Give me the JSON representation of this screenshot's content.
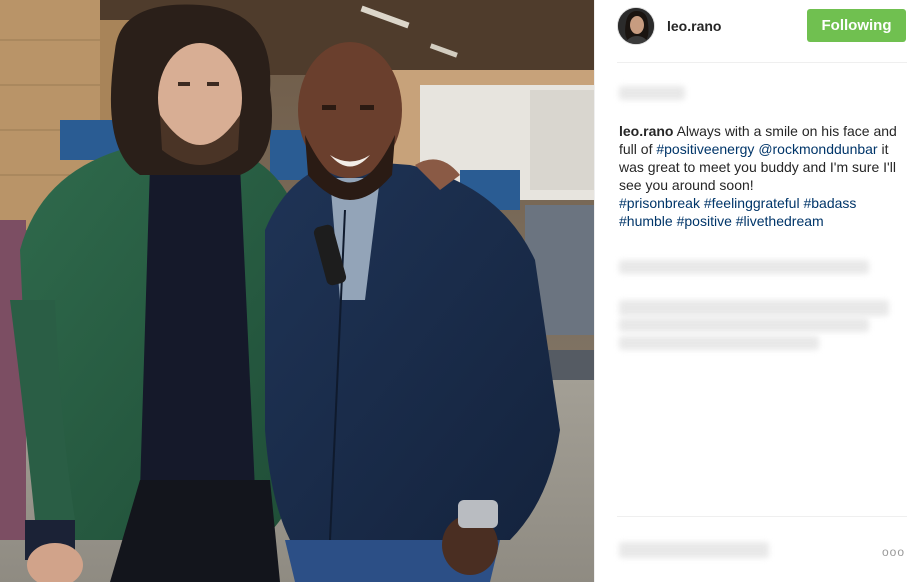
{
  "post": {
    "username": "leo.rano",
    "follow_label": "Following",
    "caption_user": "leo.rano",
    "caption_parts": [
      {
        "type": "text",
        "text": " Always with a smile on his face and full of "
      },
      {
        "type": "tag",
        "text": "#positiveenergy"
      },
      {
        "type": "text",
        "text": " "
      },
      {
        "type": "tag",
        "text": "@rockmonddunbar"
      },
      {
        "type": "text",
        "text": " it was great to meet you buddy and I'm sure I'll see you around soon!"
      },
      {
        "type": "br"
      },
      {
        "type": "tag",
        "text": "#prisonbreak"
      },
      {
        "type": "text",
        "text": " "
      },
      {
        "type": "tag",
        "text": "#feelinggrateful"
      },
      {
        "type": "text",
        "text": " "
      },
      {
        "type": "tag",
        "text": "#badass"
      },
      {
        "type": "text",
        "text": " "
      },
      {
        "type": "tag",
        "text": "#humble"
      },
      {
        "type": "text",
        "text": " "
      },
      {
        "type": "tag",
        "text": "#positive"
      },
      {
        "type": "text",
        "text": " "
      },
      {
        "type": "tag",
        "text": "#livethedream"
      }
    ],
    "more_icon": "ooo"
  },
  "colors": {
    "follow_button": "#70c050",
    "hashtag": "#003569",
    "text": "#262626"
  },
  "icons": {
    "more": "more-options-icon"
  }
}
